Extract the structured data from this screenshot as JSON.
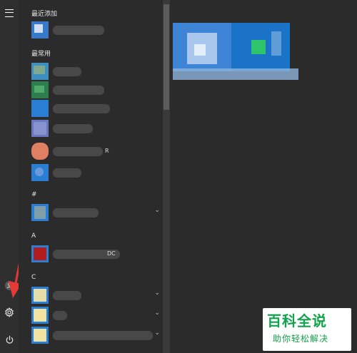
{
  "left_rail": {
    "menu_icon": "hamburger-icon",
    "user_icon": "user-icon",
    "settings_icon": "gear-icon",
    "power_icon": "power-icon"
  },
  "app_list": {
    "recently_added_header": "最近添加",
    "most_used_header": "最常用",
    "hash_header": "#",
    "a_header": "A",
    "c_header": "C",
    "partial_label_r": "R",
    "partial_label_dc": "DC"
  },
  "annotation": {
    "arrow_color": "#e53935"
  },
  "watermark": {
    "title": "百科全说",
    "subtitle": "助你轻松解决",
    "color": "#11a34b"
  }
}
